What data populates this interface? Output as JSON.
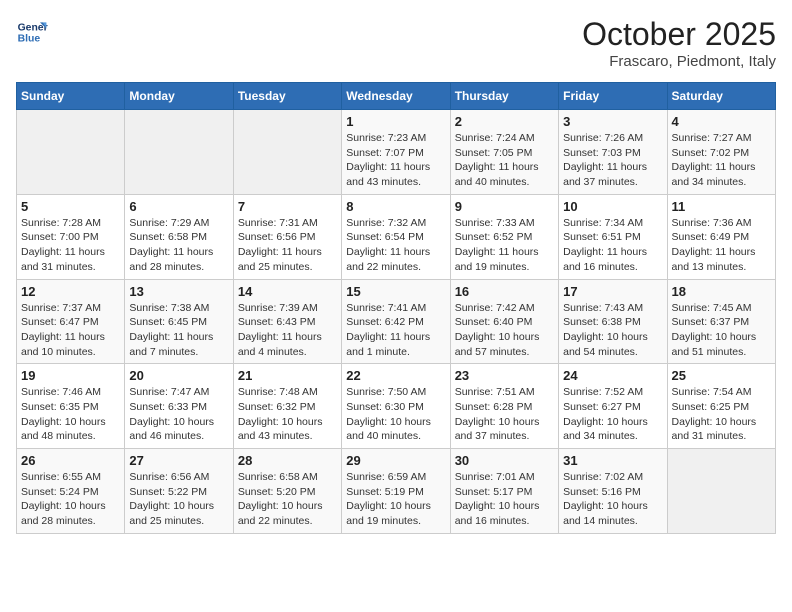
{
  "header": {
    "logo_line1": "General",
    "logo_line2": "Blue",
    "month": "October 2025",
    "location": "Frascaro, Piedmont, Italy"
  },
  "days_of_week": [
    "Sunday",
    "Monday",
    "Tuesday",
    "Wednesday",
    "Thursday",
    "Friday",
    "Saturday"
  ],
  "weeks": [
    [
      {
        "day": "",
        "info": ""
      },
      {
        "day": "",
        "info": ""
      },
      {
        "day": "",
        "info": ""
      },
      {
        "day": "1",
        "info": "Sunrise: 7:23 AM\nSunset: 7:07 PM\nDaylight: 11 hours and 43 minutes."
      },
      {
        "day": "2",
        "info": "Sunrise: 7:24 AM\nSunset: 7:05 PM\nDaylight: 11 hours and 40 minutes."
      },
      {
        "day": "3",
        "info": "Sunrise: 7:26 AM\nSunset: 7:03 PM\nDaylight: 11 hours and 37 minutes."
      },
      {
        "day": "4",
        "info": "Sunrise: 7:27 AM\nSunset: 7:02 PM\nDaylight: 11 hours and 34 minutes."
      }
    ],
    [
      {
        "day": "5",
        "info": "Sunrise: 7:28 AM\nSunset: 7:00 PM\nDaylight: 11 hours and 31 minutes."
      },
      {
        "day": "6",
        "info": "Sunrise: 7:29 AM\nSunset: 6:58 PM\nDaylight: 11 hours and 28 minutes."
      },
      {
        "day": "7",
        "info": "Sunrise: 7:31 AM\nSunset: 6:56 PM\nDaylight: 11 hours and 25 minutes."
      },
      {
        "day": "8",
        "info": "Sunrise: 7:32 AM\nSunset: 6:54 PM\nDaylight: 11 hours and 22 minutes."
      },
      {
        "day": "9",
        "info": "Sunrise: 7:33 AM\nSunset: 6:52 PM\nDaylight: 11 hours and 19 minutes."
      },
      {
        "day": "10",
        "info": "Sunrise: 7:34 AM\nSunset: 6:51 PM\nDaylight: 11 hours and 16 minutes."
      },
      {
        "day": "11",
        "info": "Sunrise: 7:36 AM\nSunset: 6:49 PM\nDaylight: 11 hours and 13 minutes."
      }
    ],
    [
      {
        "day": "12",
        "info": "Sunrise: 7:37 AM\nSunset: 6:47 PM\nDaylight: 11 hours and 10 minutes."
      },
      {
        "day": "13",
        "info": "Sunrise: 7:38 AM\nSunset: 6:45 PM\nDaylight: 11 hours and 7 minutes."
      },
      {
        "day": "14",
        "info": "Sunrise: 7:39 AM\nSunset: 6:43 PM\nDaylight: 11 hours and 4 minutes."
      },
      {
        "day": "15",
        "info": "Sunrise: 7:41 AM\nSunset: 6:42 PM\nDaylight: 11 hours and 1 minute."
      },
      {
        "day": "16",
        "info": "Sunrise: 7:42 AM\nSunset: 6:40 PM\nDaylight: 10 hours and 57 minutes."
      },
      {
        "day": "17",
        "info": "Sunrise: 7:43 AM\nSunset: 6:38 PM\nDaylight: 10 hours and 54 minutes."
      },
      {
        "day": "18",
        "info": "Sunrise: 7:45 AM\nSunset: 6:37 PM\nDaylight: 10 hours and 51 minutes."
      }
    ],
    [
      {
        "day": "19",
        "info": "Sunrise: 7:46 AM\nSunset: 6:35 PM\nDaylight: 10 hours and 48 minutes."
      },
      {
        "day": "20",
        "info": "Sunrise: 7:47 AM\nSunset: 6:33 PM\nDaylight: 10 hours and 46 minutes."
      },
      {
        "day": "21",
        "info": "Sunrise: 7:48 AM\nSunset: 6:32 PM\nDaylight: 10 hours and 43 minutes."
      },
      {
        "day": "22",
        "info": "Sunrise: 7:50 AM\nSunset: 6:30 PM\nDaylight: 10 hours and 40 minutes."
      },
      {
        "day": "23",
        "info": "Sunrise: 7:51 AM\nSunset: 6:28 PM\nDaylight: 10 hours and 37 minutes."
      },
      {
        "day": "24",
        "info": "Sunrise: 7:52 AM\nSunset: 6:27 PM\nDaylight: 10 hours and 34 minutes."
      },
      {
        "day": "25",
        "info": "Sunrise: 7:54 AM\nSunset: 6:25 PM\nDaylight: 10 hours and 31 minutes."
      }
    ],
    [
      {
        "day": "26",
        "info": "Sunrise: 6:55 AM\nSunset: 5:24 PM\nDaylight: 10 hours and 28 minutes."
      },
      {
        "day": "27",
        "info": "Sunrise: 6:56 AM\nSunset: 5:22 PM\nDaylight: 10 hours and 25 minutes."
      },
      {
        "day": "28",
        "info": "Sunrise: 6:58 AM\nSunset: 5:20 PM\nDaylight: 10 hours and 22 minutes."
      },
      {
        "day": "29",
        "info": "Sunrise: 6:59 AM\nSunset: 5:19 PM\nDaylight: 10 hours and 19 minutes."
      },
      {
        "day": "30",
        "info": "Sunrise: 7:01 AM\nSunset: 5:17 PM\nDaylight: 10 hours and 16 minutes."
      },
      {
        "day": "31",
        "info": "Sunrise: 7:02 AM\nSunset: 5:16 PM\nDaylight: 10 hours and 14 minutes."
      },
      {
        "day": "",
        "info": ""
      }
    ]
  ]
}
